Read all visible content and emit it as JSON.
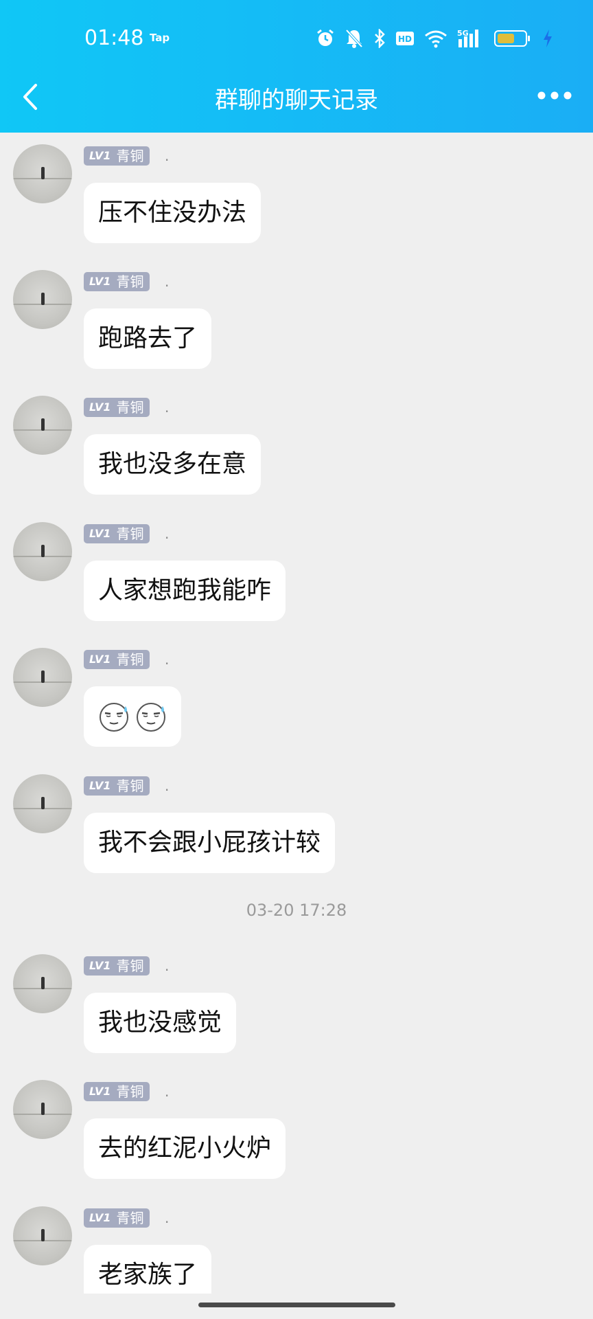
{
  "status_bar": {
    "time": "01:48",
    "tap": "Tap",
    "network": "5G",
    "hd": "HD"
  },
  "nav": {
    "title": "群聊的聊天记录"
  },
  "badge": {
    "level": "LV1",
    "rank": "青铜"
  },
  "messages": [
    {
      "sender": ".",
      "text": "压不住没办法"
    },
    {
      "sender": ".",
      "text": "跑路去了"
    },
    {
      "sender": ".",
      "text": "我也没多在意"
    },
    {
      "sender": ".",
      "text": "人家想跑我能咋"
    },
    {
      "sender": ".",
      "text": "",
      "emoji": [
        "sweat-smile-emoji",
        "sweat-smile-emoji"
      ]
    },
    {
      "sender": ".",
      "text": "我不会跟小屁孩计较"
    },
    {
      "sender": ".",
      "text": "我也没感觉"
    },
    {
      "sender": ".",
      "text": "去的红泥小火炉"
    },
    {
      "sender": ".",
      "text": "老家族了"
    }
  ],
  "timestamp": "03-20 17:28",
  "colors": {
    "header_start": "#10c7f6",
    "header_end": "#1aaef5",
    "background": "#efefef",
    "badge": "#a5abc0",
    "bubble": "#ffffff"
  }
}
